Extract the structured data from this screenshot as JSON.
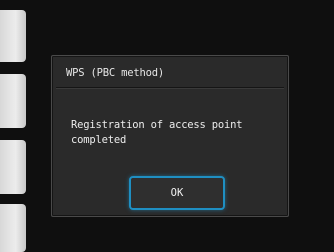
{
  "dialog": {
    "title": "WPS (PBC method)",
    "message": "Registration of access point completed",
    "ok_label": "OK"
  },
  "colors": {
    "background": "#0f0f0f",
    "dialog_bg": "#2a2a2a",
    "focus_outline": "#1f8fc2",
    "text": "#ececec"
  }
}
